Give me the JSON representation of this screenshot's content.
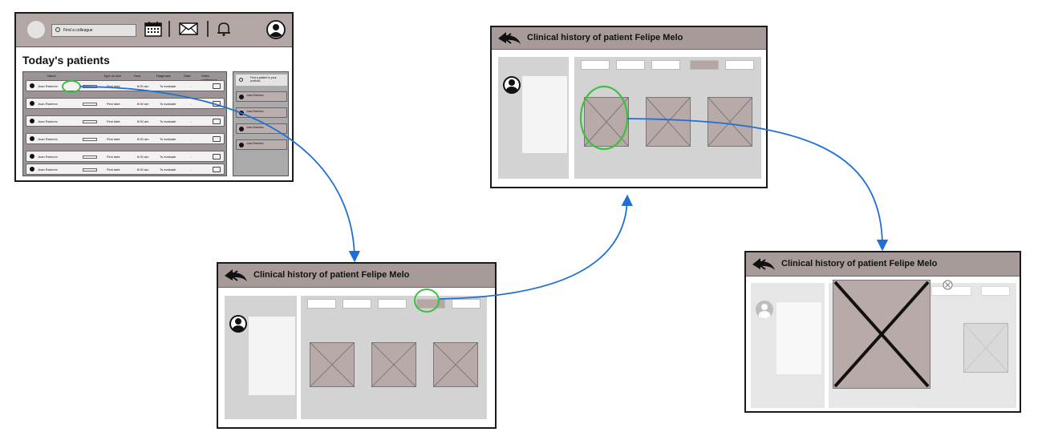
{
  "dashboard": {
    "search_placeholder": "Find a colleague",
    "page_title": "Today's patients",
    "table_headers": [
      "Name",
      "Type of care",
      "Hour",
      "Diagnosis",
      "Start",
      "Video conference"
    ],
    "rows": [
      {
        "name": "Juan Ramírez",
        "type": "First date",
        "hour": "8:00 am",
        "diagnosis": "To evaluate",
        "start": "-"
      },
      {
        "name": "Juan Ramírez",
        "type": "First date",
        "hour": "8:00 am",
        "diagnosis": "To evaluate",
        "start": "-"
      },
      {
        "name": "Juan Ramírez",
        "type": "First date",
        "hour": "8:00 am",
        "diagnosis": "To evaluate",
        "start": "-"
      },
      {
        "name": "Juan Ramírez",
        "type": "First date",
        "hour": "8:00 am",
        "diagnosis": "To evaluate",
        "start": "-"
      },
      {
        "name": "Juan Ramírez",
        "type": "First date",
        "hour": "8:00 am",
        "diagnosis": "To evaluate",
        "start": "-"
      },
      {
        "name": "Juan Ramírez",
        "type": "First date",
        "hour": "8:00 am",
        "diagnosis": "To evaluate",
        "start": "-"
      }
    ],
    "side_search": "Find a patient in your portfolio",
    "side_cards": [
      {
        "name": "Juan Ramírez"
      },
      {
        "name": "Juan Ramírez"
      },
      {
        "name": "Juan Ramírez"
      },
      {
        "name": "Juan Ramírez"
      }
    ]
  },
  "clinical_history": {
    "title": "Clinical history of patient Felipe Melo",
    "active_tab_index": 3
  },
  "colors": {
    "header": "#a79b99",
    "accent_circle": "#3fbf3f",
    "flow_arrow": "#1f6fd6",
    "placeholder_image": "#b8aaa8"
  }
}
